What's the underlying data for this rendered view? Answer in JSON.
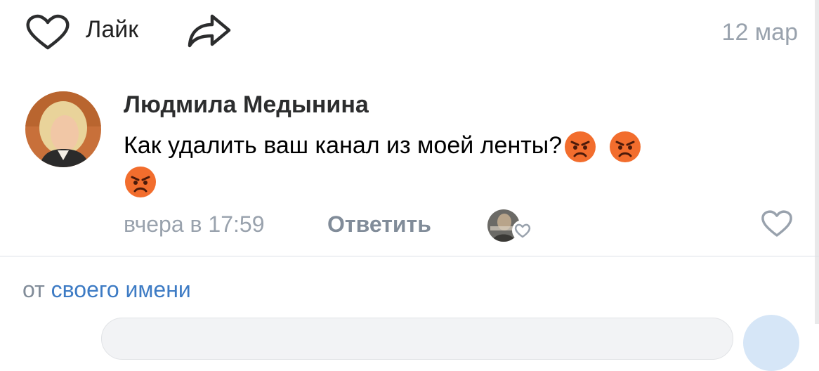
{
  "post_actions": {
    "like_label": "Лайк",
    "date": "12 мар",
    "icons": [
      "heart-outline-icon",
      "share-arrow-icon"
    ]
  },
  "comment": {
    "author": "Людмила Медынина",
    "text": "Как удалить ваш канал из моей ленты?",
    "emojis": [
      "angry-face",
      "angry-face",
      "angry-face"
    ],
    "timestamp": "вчера в 17:59",
    "reply_label": "Ответить"
  },
  "composer": {
    "from_label": "от",
    "identity_label": "своего имени"
  },
  "colors": {
    "secondary_text": "#99a2ad",
    "link": "#3d7bc4",
    "divider": "#dce1e6",
    "emoji": "#f26d2d"
  }
}
